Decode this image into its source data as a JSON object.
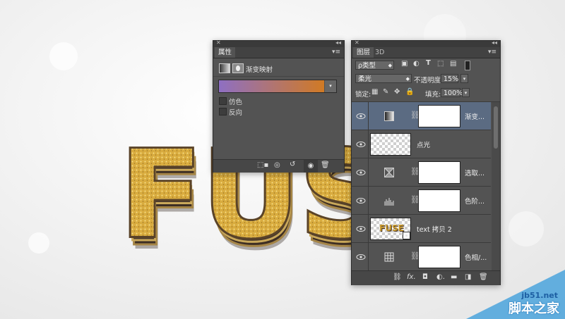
{
  "properties_panel": {
    "tab_label": "属性",
    "adjustment_title": "渐变映射",
    "gradient": {
      "start_color": "#8e6fc3",
      "end_color": "#d17a24"
    },
    "dither_label": "仿色",
    "dither_checked": false,
    "reverse_label": "反向",
    "reverse_checked": false,
    "footer_icons": [
      "clip-to-layer-icon",
      "view-previous-state-icon",
      "reset-icon",
      "visibility-icon",
      "delete-icon"
    ]
  },
  "layers_panel": {
    "tabs": [
      {
        "label": "图层",
        "active": true
      },
      {
        "label": "3D",
        "active": false
      }
    ],
    "filter": {
      "value": "ρ类型"
    },
    "blend_mode": {
      "value": "柔光"
    },
    "opacity_label": "不透明度:",
    "opacity_value": "15%",
    "lock_label": "锁定:",
    "fill_label": "填充:",
    "fill_value": "100%",
    "layers": [
      {
        "name": "渐变...",
        "icon": "gradient-map-icon",
        "selected": true
      },
      {
        "name": "点光",
        "icon": "transparent-thumb",
        "selected": false
      },
      {
        "name": "选取...",
        "icon": "selective-color-icon",
        "selected": false
      },
      {
        "name": "色阶...",
        "icon": "levels-icon",
        "selected": false
      },
      {
        "name": "text 拷贝 2",
        "icon": "text-thumb",
        "thumb_text": "FUSE",
        "selected": false
      },
      {
        "name": "色相/...",
        "icon": "hue-saturation-icon",
        "selected": false
      }
    ],
    "footer_icons": [
      "link-icon",
      "fx-icon",
      "mask-icon",
      "adjustment-icon",
      "folder-icon",
      "new-layer-icon",
      "delete-icon"
    ]
  },
  "artwork": {
    "text": "FUSE",
    "gold_color": "#d9ac3f",
    "dark_color": "#3d2e24"
  },
  "watermark": {
    "site": "jb51.net",
    "name": "脚本之家"
  }
}
